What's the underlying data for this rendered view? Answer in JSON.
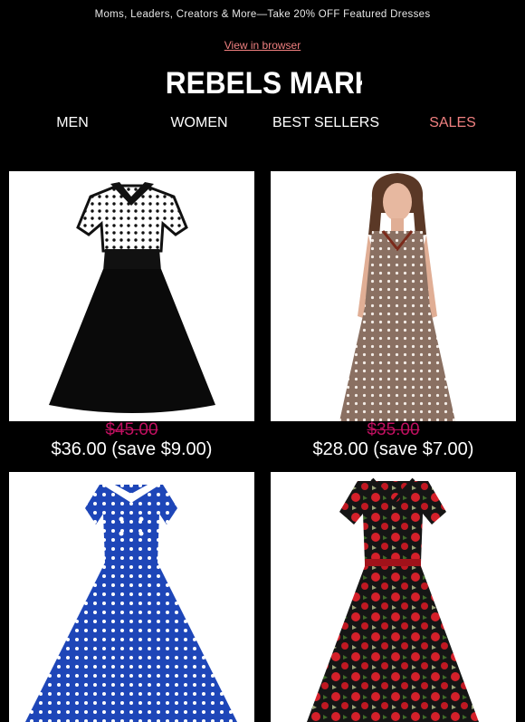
{
  "banner": {
    "text": "Moms, Leaders, Creators & More—Take 20% OFF Featured Dresses"
  },
  "view_in_browser": "View in browser",
  "logo": {
    "text": "REBELS MARKET"
  },
  "nav": [
    {
      "label": "MEN"
    },
    {
      "label": "WOMEN"
    },
    {
      "label": "BEST SELLERS"
    },
    {
      "label": "SALES"
    }
  ],
  "products": [
    {
      "image": "black-polka-dot-dress-image",
      "old_price": "$45.00",
      "new_price": "$36.00 (save $9.00)"
    },
    {
      "image": "brown-polka-dot-dress-image",
      "old_price": "$35.00",
      "new_price": "$28.00 (save $7.00)"
    },
    {
      "image": "blue-polka-dot-dress-image",
      "old_price": "",
      "new_price": ""
    },
    {
      "image": "red-rose-print-dress-image",
      "old_price": "",
      "new_price": ""
    }
  ],
  "colors": {
    "background": "#000000",
    "accent": "#f08080",
    "strike": "#c01060"
  }
}
